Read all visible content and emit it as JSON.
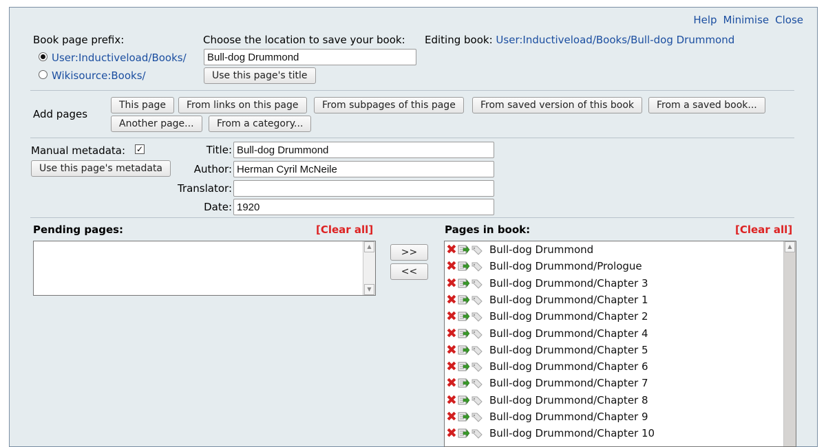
{
  "nav": {
    "help": "Help",
    "minimise": "Minimise",
    "close": "Close"
  },
  "prefix": {
    "label": "Book page prefix:",
    "options": [
      "User:Inductiveload/Books/",
      "Wikisource:Books/"
    ],
    "selected": 0
  },
  "location": {
    "label": "Choose the location to save your book:",
    "value": "Bull-dog Drummond",
    "use_title_button": "Use this page's title"
  },
  "editing": {
    "label": "Editing book:",
    "link": "User:Inductiveload/Books/Bull-dog Drummond"
  },
  "add_pages": {
    "label": "Add pages",
    "buttons": [
      "This page",
      "From links on this page",
      "From subpages of this page",
      "From saved version of this book",
      "From a saved book...",
      "Another page...",
      "From a category..."
    ]
  },
  "metadata": {
    "manual_label": "Manual metadata:",
    "manual_checked": true,
    "use_metadata_button": "Use this page's metadata",
    "title_label": "Title:",
    "title_value": "Bull-dog Drummond",
    "author_label": "Author:",
    "author_value": "Herman Cyril McNeile",
    "translator_label": "Translator:",
    "translator_value": "",
    "date_label": "Date:",
    "date_value": "1920"
  },
  "pending": {
    "label": "Pending pages:",
    "clear": "[Clear all]"
  },
  "move_buttons": {
    "add": ">>",
    "remove": "<<"
  },
  "book": {
    "label": "Pages in book:",
    "clear": "[Clear all]",
    "pages": [
      "Bull-dog Drummond",
      "Bull-dog Drummond/Prologue",
      "Bull-dog Drummond/Chapter 3",
      "Bull-dog Drummond/Chapter 1",
      "Bull-dog Drummond/Chapter 2",
      "Bull-dog Drummond/Chapter 4",
      "Bull-dog Drummond/Chapter 5",
      "Bull-dog Drummond/Chapter 6",
      "Bull-dog Drummond/Chapter 7",
      "Bull-dog Drummond/Chapter 8",
      "Bull-dog Drummond/Chapter 9",
      "Bull-dog Drummond/Chapter 10"
    ]
  }
}
